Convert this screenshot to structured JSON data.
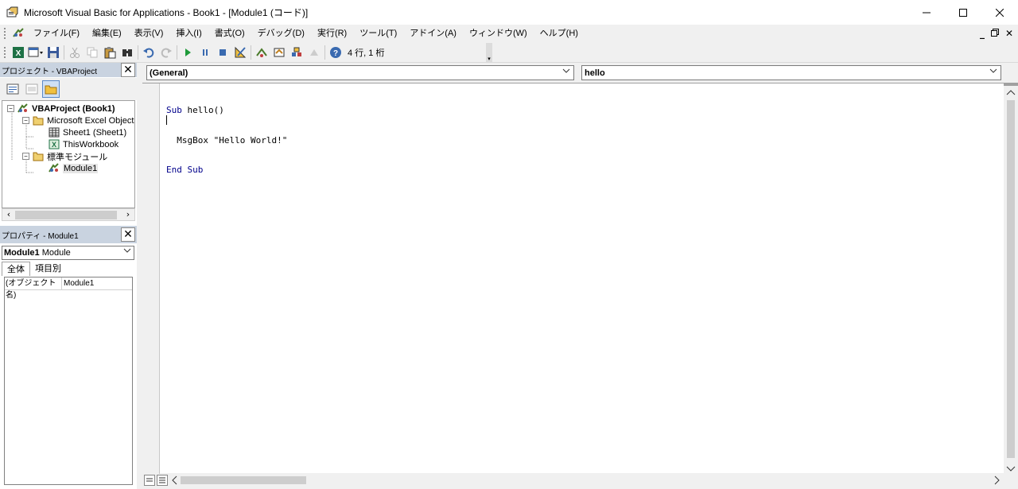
{
  "window": {
    "title": "Microsoft Visual Basic for Applications - Book1 - [Module1 (コード)]",
    "controls": [
      "—",
      "☐",
      "✕"
    ]
  },
  "menu": {
    "items": [
      "ファイル(F)",
      "編集(E)",
      "表示(V)",
      "挿入(I)",
      "書式(O)",
      "デバッグ(D)",
      "実行(R)",
      "ツール(T)",
      "アドイン(A)",
      "ウィンドウ(W)",
      "ヘルプ(H)"
    ],
    "mdi_controls": [
      "_",
      "🗗",
      "✕"
    ]
  },
  "toolbar": {
    "position_label": "4 行, 1 桁"
  },
  "project_pane": {
    "title": "プロジェクト - VBAProject",
    "tree": [
      {
        "label": "VBAProject (Book1)",
        "level": 0,
        "expander": "−"
      },
      {
        "label": "Microsoft Excel Objects",
        "level": 1,
        "expander": "−"
      },
      {
        "label": "Sheet1 (Sheet1)",
        "level": 2
      },
      {
        "label": "ThisWorkbook",
        "level": 2
      },
      {
        "label": "標準モジュール",
        "level": 1,
        "expander": "−"
      },
      {
        "label": "Module1",
        "level": 2
      }
    ]
  },
  "properties_pane": {
    "title": "プロパティ - Module1",
    "object_name": "Module1",
    "object_type": "Module",
    "tabs": [
      "全体",
      "項目別"
    ],
    "rows": [
      {
        "name": "(オブジェクト名)",
        "value": "Module1"
      }
    ]
  },
  "code_window": {
    "object_combo": "(General)",
    "proc_combo": "hello",
    "lines": [
      {
        "kw": "Sub",
        "rest": " hello()"
      },
      {
        "kw": "",
        "rest": "  MsgBox \"Hello World!\""
      },
      {
        "kw": "End Sub",
        "rest": ""
      }
    ]
  },
  "colors": {
    "keyword": "#00008b",
    "pane_header": "#c9d3e0",
    "chrome": "#f0f0f0"
  }
}
